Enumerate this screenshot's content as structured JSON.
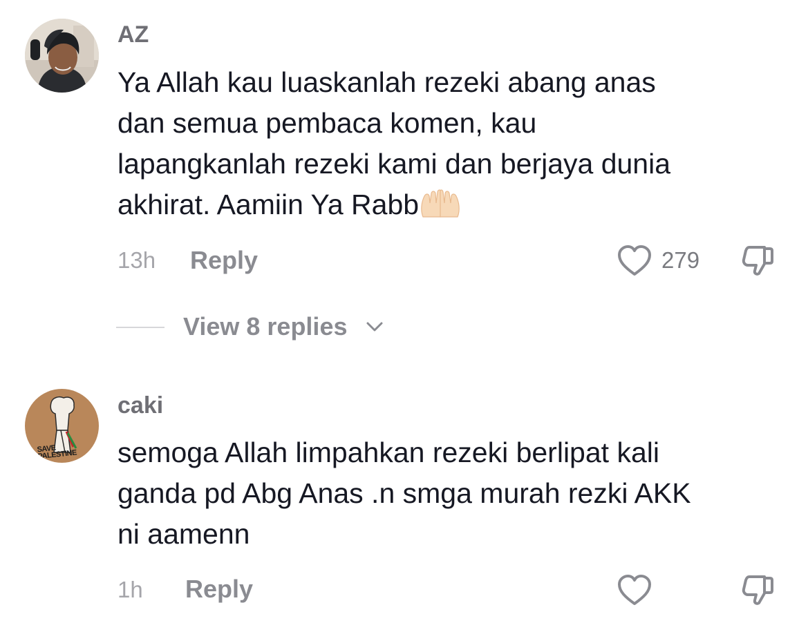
{
  "comments": [
    {
      "username": "AZ",
      "lines": [
        "Ya Allah kau luaskanlah rezeki abang anas",
        "dan semua pembaca komen, kau",
        "lapangkanlah rezeki kami dan berjaya dunia",
        "akhirat. Aamiin Ya Rabb"
      ],
      "emoji": "folded-hands-emoji",
      "time": "13h",
      "reply_label": "Reply",
      "like_count": "279",
      "view_replies_label": "View 8 replies"
    },
    {
      "username": "caki",
      "lines": [
        "semoga Allah limpahkan rezeki berlipat kali",
        "ganda pd Abg Anas .n smga murah rezki AKK",
        "ni aamenn"
      ],
      "avatar_text": "SAVE PALESTINE",
      "time": "1h",
      "reply_label": "Reply"
    }
  ],
  "icons": {
    "like": "heart-icon",
    "dislike": "thumbs-down-icon",
    "expand": "chevron-down-icon"
  },
  "colors": {
    "text": "#161823",
    "muted": "#8a8b91",
    "avatar2_bg": "#b9875a"
  }
}
